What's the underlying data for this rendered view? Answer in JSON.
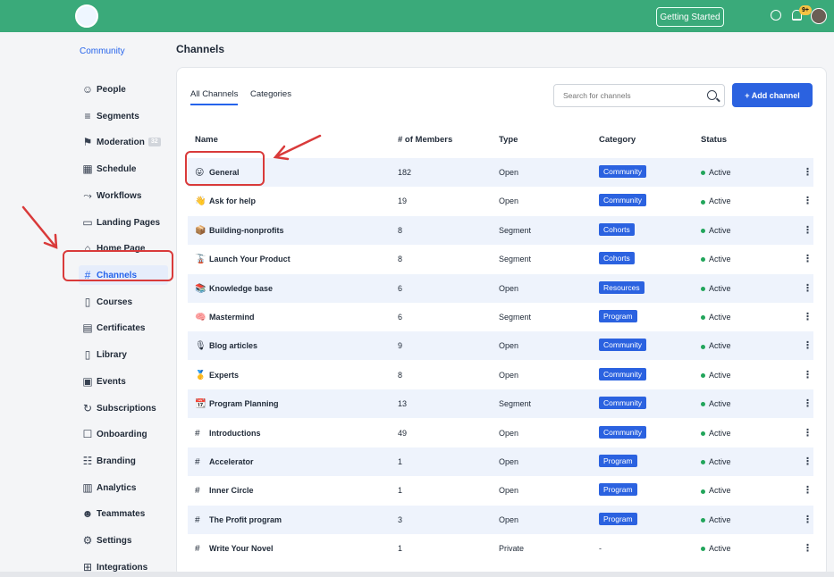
{
  "header": {
    "logo_text": "",
    "getting_started_label": "Getting Started",
    "notification_count": "9+"
  },
  "sidebar": {
    "section_title": "Community",
    "items": [
      {
        "label": "People",
        "icon": "people-icon",
        "glyph": "☺"
      },
      {
        "label": "Segments",
        "icon": "segments-icon",
        "glyph": "≡"
      },
      {
        "label": "Moderation",
        "icon": "moderation-flag-icon",
        "glyph": "⚑",
        "count": "32"
      },
      {
        "label": "Schedule",
        "icon": "calendar-icon",
        "glyph": "▦"
      },
      {
        "label": "Workflows",
        "icon": "workflow-icon",
        "glyph": "⤳"
      },
      {
        "label": "Landing Pages",
        "icon": "landing-page-icon",
        "glyph": "▭"
      },
      {
        "label": "Home Page",
        "icon": "home-icon",
        "glyph": "⌂"
      },
      {
        "label": "Channels",
        "icon": "hash-icon",
        "glyph": "#",
        "active": true
      },
      {
        "label": "Courses",
        "icon": "book-open-icon",
        "glyph": "▯"
      },
      {
        "label": "Certificates",
        "icon": "certificate-icon",
        "glyph": "▤"
      },
      {
        "label": "Library",
        "icon": "library-icon",
        "glyph": "▯"
      },
      {
        "label": "Events",
        "icon": "event-calendar-icon",
        "glyph": "▣"
      },
      {
        "label": "Subscriptions",
        "icon": "subscription-icon",
        "glyph": "↻"
      },
      {
        "label": "Onboarding",
        "icon": "onboarding-icon",
        "glyph": "☐"
      },
      {
        "label": "Branding",
        "icon": "branding-icon",
        "glyph": "☷"
      },
      {
        "label": "Analytics",
        "icon": "analytics-icon",
        "glyph": "▥"
      },
      {
        "label": "Teammates",
        "icon": "teammates-icon",
        "glyph": "☻"
      },
      {
        "label": "Settings",
        "icon": "settings-gear-icon",
        "glyph": "⚙"
      },
      {
        "label": "Integrations",
        "icon": "integrations-icon",
        "glyph": "⊞"
      }
    ]
  },
  "main": {
    "page_title": "Channels",
    "tabs": [
      {
        "label": "All Channels",
        "active": true
      },
      {
        "label": "Categories",
        "active": false
      }
    ],
    "search_placeholder": "Search for channels",
    "add_button_label": "+ Add channel",
    "columns": [
      "Name",
      "# of Members",
      "Type",
      "Category",
      "Status"
    ],
    "rows": [
      {
        "emoji": "😛",
        "name": "General",
        "members": "182",
        "type": "Open",
        "category": "Community",
        "status": "Active"
      },
      {
        "emoji": "👋",
        "name": "Ask for help",
        "members": "19",
        "type": "Open",
        "category": "Community",
        "status": "Active"
      },
      {
        "emoji": "📦",
        "name": "Building-nonprofits",
        "members": "8",
        "type": "Segment",
        "category": "Cohorts",
        "status": "Active"
      },
      {
        "emoji": "🚡",
        "name": "Launch Your Product",
        "members": "8",
        "type": "Segment",
        "category": "Cohorts",
        "status": "Active"
      },
      {
        "emoji": "📚",
        "name": "Knowledge base",
        "members": "6",
        "type": "Open",
        "category": "Resources",
        "status": "Active"
      },
      {
        "emoji": "🧠",
        "name": "Mastermind",
        "members": "6",
        "type": "Segment",
        "category": "Program",
        "status": "Active"
      },
      {
        "emoji": "🎙",
        "name": "Blog articles",
        "members": "9",
        "type": "Open",
        "category": "Community",
        "status": "Active"
      },
      {
        "emoji": "🥇",
        "name": "Experts",
        "members": "8",
        "type": "Open",
        "category": "Community",
        "status": "Active"
      },
      {
        "emoji": "📆",
        "name": "Program Planning",
        "members": "13",
        "type": "Segment",
        "category": "Community",
        "status": "Active"
      },
      {
        "emoji": "#",
        "name": "Introductions",
        "members": "49",
        "type": "Open",
        "category": "Community",
        "status": "Active"
      },
      {
        "emoji": "#",
        "name": "Accelerator",
        "members": "1",
        "type": "Open",
        "category": "Program",
        "status": "Active"
      },
      {
        "emoji": "#",
        "name": "Inner Circle",
        "members": "1",
        "type": "Open",
        "category": "Program",
        "status": "Active"
      },
      {
        "emoji": "#",
        "name": "The Profit program",
        "members": "3",
        "type": "Open",
        "category": "Program",
        "status": "Active"
      },
      {
        "emoji": "#",
        "name": "Write Your Novel",
        "members": "1",
        "type": "Private",
        "category": "-",
        "status": "Active"
      }
    ]
  },
  "colors": {
    "topbar": "#3aaa7a",
    "accent": "#2b62e0",
    "active_status": "#22a55b",
    "annotation": "#d93a3a"
  }
}
